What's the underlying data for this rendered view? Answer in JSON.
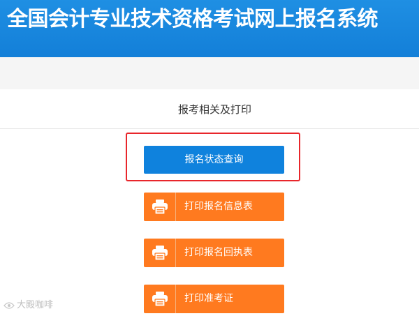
{
  "header": {
    "title": "全国会计专业技术资格考试网上报名系统"
  },
  "section": {
    "title": "报考相关及打印"
  },
  "buttons": {
    "status_query": "报名状态查询",
    "print_info": "打印报名信息表",
    "print_receipt": "打印报名回执表",
    "print_admission": "打印准考证"
  },
  "icons": {
    "printer": "printer-icon",
    "watermark": "watermark-logo-icon"
  },
  "watermark": {
    "text": "大殿咖啡"
  },
  "colors": {
    "header_blue": "#137fd8",
    "query_blue": "#0f82dd",
    "print_orange": "#ff7a1f",
    "highlight_red": "#e8262b"
  }
}
